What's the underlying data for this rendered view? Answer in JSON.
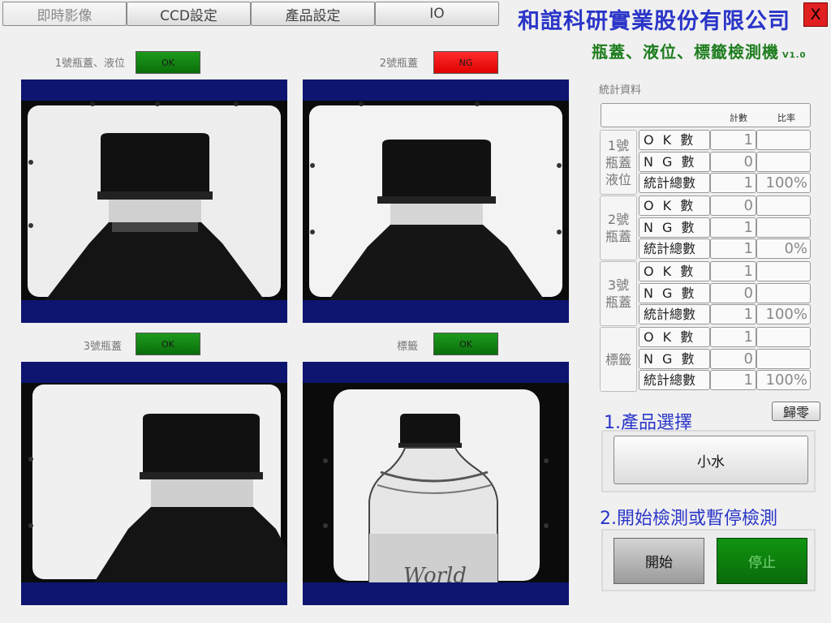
{
  "tabs": [
    {
      "label": "即時影像"
    },
    {
      "label": "CCD設定"
    },
    {
      "label": "產品設定"
    },
    {
      "label": "IO"
    }
  ],
  "header": {
    "company": "和誼科研實業股份有限公司",
    "close_label": "X",
    "subtitle": "瓶蓋、液位、標籤檢測機",
    "version": "V1.0"
  },
  "cameras": [
    {
      "label": "1號瓶蓋、液位",
      "status": "OK",
      "status_color": "#0a7a0a"
    },
    {
      "label": "2號瓶蓋",
      "status": "NG",
      "status_color": "#ff1a1a"
    },
    {
      "label": "3號瓶蓋",
      "status": "OK",
      "status_color": "#0a7a0a"
    },
    {
      "label": "標籤",
      "status": "OK",
      "status_color": "#0a7a0a"
    }
  ],
  "stats": {
    "title": "統計資料",
    "col_count": "計數",
    "col_ratio": "比率",
    "groups": [
      {
        "name_lines": [
          "1號",
          "瓶蓋",
          "液位"
        ],
        "rows": [
          {
            "label": "O K 數",
            "count": "1",
            "pct": ""
          },
          {
            "label": "N G 數",
            "count": "0",
            "pct": ""
          },
          {
            "label": "統計總數",
            "count": "1",
            "pct": "100%"
          }
        ]
      },
      {
        "name_lines": [
          "2號",
          "瓶蓋"
        ],
        "rows": [
          {
            "label": "O K 數",
            "count": "0",
            "pct": ""
          },
          {
            "label": "N G 數",
            "count": "1",
            "pct": ""
          },
          {
            "label": "統計總數",
            "count": "1",
            "pct": "0%"
          }
        ]
      },
      {
        "name_lines": [
          "3號",
          "瓶蓋"
        ],
        "rows": [
          {
            "label": "O K 數",
            "count": "1",
            "pct": ""
          },
          {
            "label": "N G 數",
            "count": "0",
            "pct": ""
          },
          {
            "label": "統計總數",
            "count": "1",
            "pct": "100%"
          }
        ]
      },
      {
        "name_lines": [
          "標籤"
        ],
        "rows": [
          {
            "label": "O K 數",
            "count": "1",
            "pct": ""
          },
          {
            "label": "N G 數",
            "count": "0",
            "pct": ""
          },
          {
            "label": "統計總數",
            "count": "1",
            "pct": "100%"
          }
        ]
      }
    ],
    "reset_label": "歸零"
  },
  "product": {
    "section_title": "1.產品選擇",
    "selected": "小水"
  },
  "control": {
    "section_title": "2.開始檢測或暫停檢測",
    "start_label": "開始",
    "stop_label": "停止"
  },
  "colors": {
    "accent_blue": "#2a35c8",
    "title_green": "#1e7d1e",
    "camera_frame": "#0d1570"
  }
}
